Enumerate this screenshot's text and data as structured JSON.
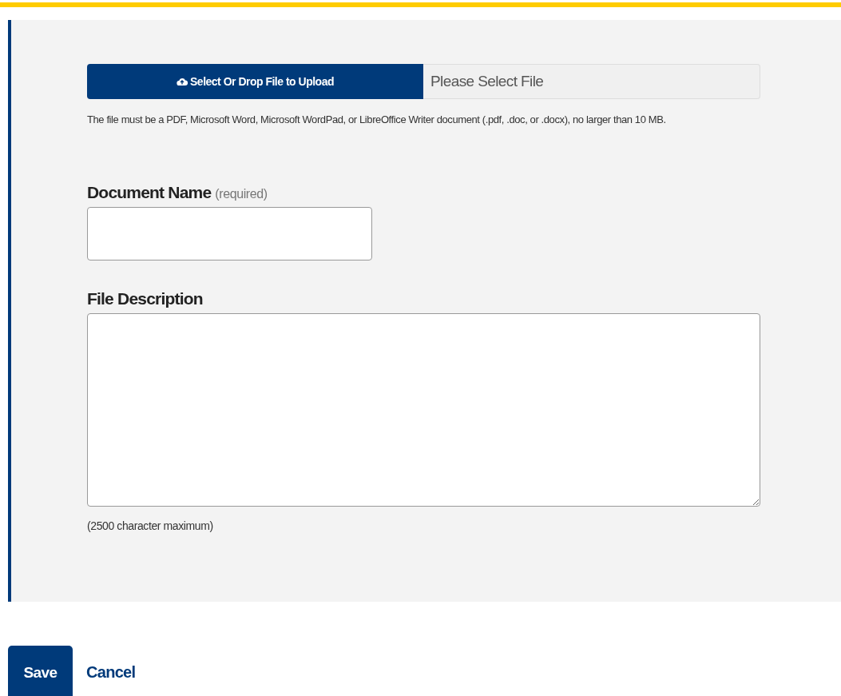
{
  "upload": {
    "button": "Select Or Drop File to Upload",
    "placeholder": "Please Select File",
    "help": "The file must be a PDF, Microsoft Word, Microsoft WordPad, or LibreOffice Writer document (.pdf, .doc, or .docx), no larger than 10 MB."
  },
  "document_name": {
    "label": "Document Name",
    "hint": "(required)"
  },
  "file_description": {
    "label": "File Description",
    "note": "(2500 character maximum)"
  },
  "buttons": {
    "save": "Save",
    "cancel": "Cancel"
  }
}
